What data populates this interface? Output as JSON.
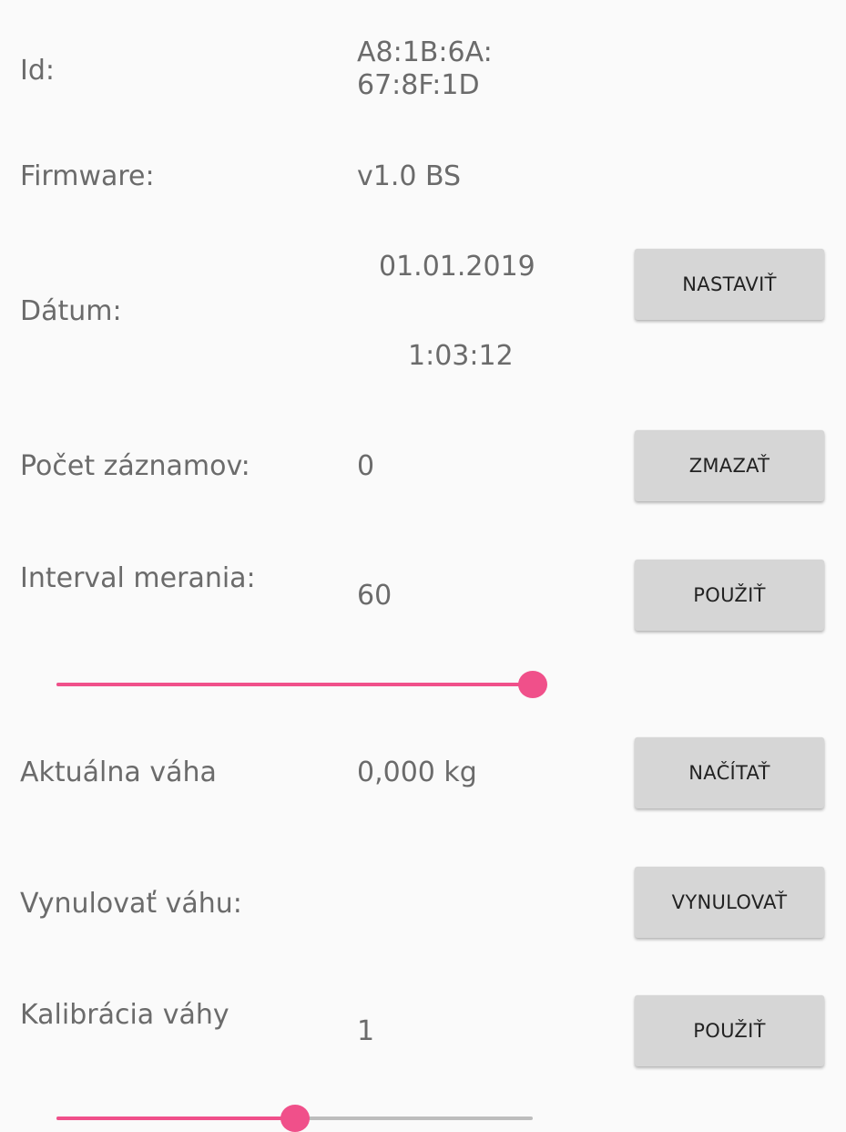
{
  "device": {
    "id_label": "Id:",
    "id_line1": "A8:1B:6A:",
    "id_line2": "67:8F:1D",
    "firmware_label": "Firmware:",
    "firmware_value": "v1.0 BS"
  },
  "date": {
    "label": "Dátum:",
    "date_value": "01.01.2019",
    "time_value": "1:03:12",
    "button": "NASTAVIŤ"
  },
  "records": {
    "label": "Počet záznamov:",
    "value": "0",
    "button": "ZMAZAŤ"
  },
  "interval": {
    "label": "Interval merania:",
    "value": "60",
    "button": "POUŽIŤ",
    "slider_fraction": 1.0
  },
  "weight": {
    "label": "Aktuálna váha",
    "value": "0,000 kg",
    "button": "NAČÍTAŤ"
  },
  "tare": {
    "label": "Vynulovať váhu:",
    "button": "VYNULOVAŤ"
  },
  "calibration": {
    "label": "Kalibrácia váhy",
    "value": "1",
    "button": "POUŽIŤ",
    "slider_fraction": 0.5
  },
  "colors": {
    "accent": "#f0508a",
    "button_bg": "#d6d6d6",
    "text": "#6b6b6b",
    "background": "#fafafa"
  }
}
